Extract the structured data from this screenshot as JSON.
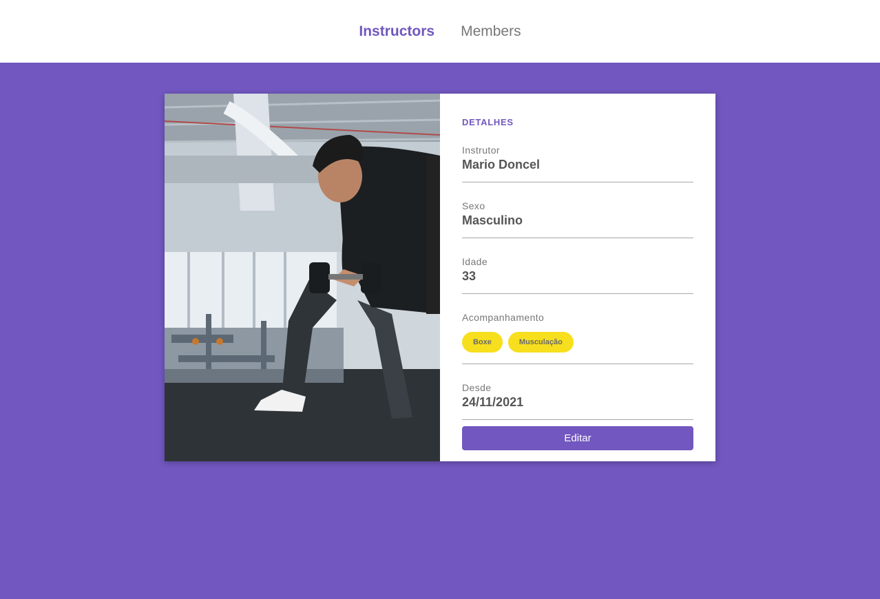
{
  "nav": {
    "items": [
      {
        "label": "Instructors",
        "active": true
      },
      {
        "label": "Members",
        "active": false
      }
    ]
  },
  "details": {
    "section_title": "DETALHES",
    "fields": [
      {
        "label": "Instrutor",
        "value": "Mario Doncel"
      },
      {
        "label": "Sexo",
        "value": "Masculino"
      },
      {
        "label": "Idade",
        "value": "33"
      },
      {
        "label": "Acompanhamento",
        "tags": [
          "Boxe",
          "Musculação"
        ]
      },
      {
        "label": "Desde",
        "value": "24/11/2021"
      }
    ],
    "edit_label": "Editar"
  },
  "colors": {
    "accent": "#7157bf",
    "tag": "#f7df1e",
    "header_bg": "#ffffff"
  }
}
